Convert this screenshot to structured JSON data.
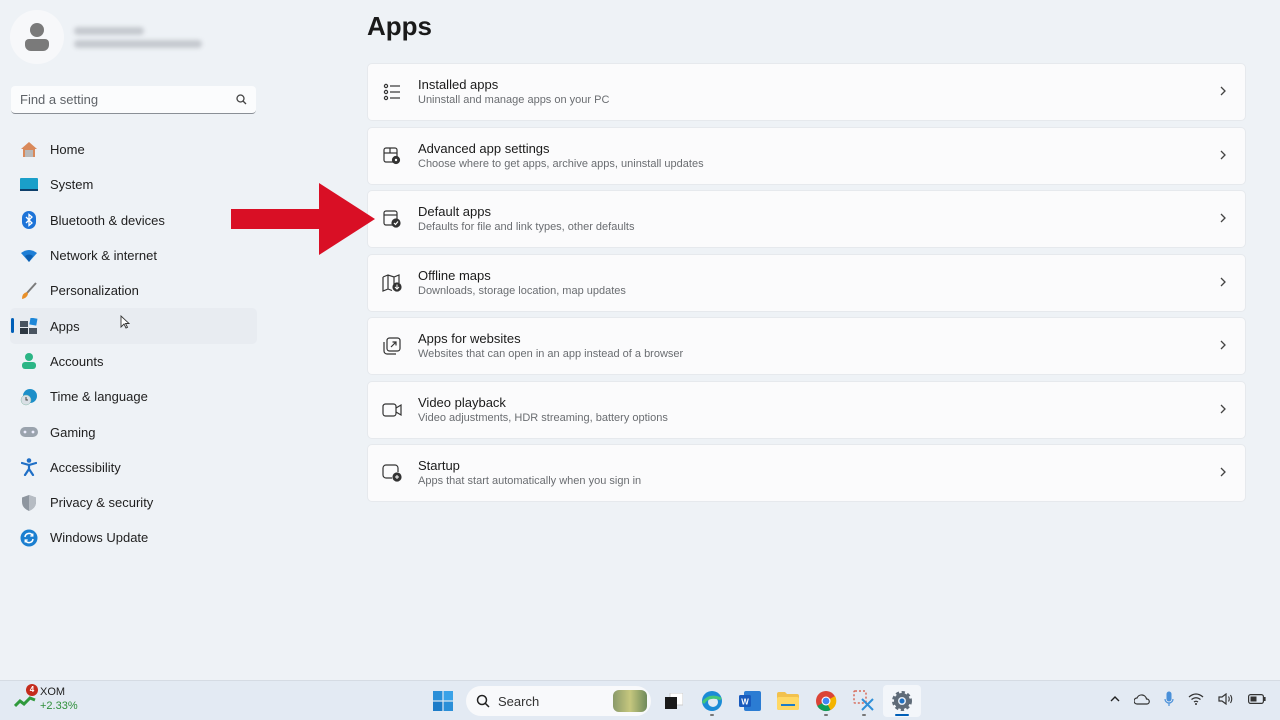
{
  "sidebar": {
    "search_placeholder": "Find a setting",
    "items": [
      {
        "label": "Home",
        "icon": "home-icon"
      },
      {
        "label": "System",
        "icon": "system-icon"
      },
      {
        "label": "Bluetooth & devices",
        "icon": "bluetooth-icon"
      },
      {
        "label": "Network & internet",
        "icon": "wifi-icon"
      },
      {
        "label": "Personalization",
        "icon": "brush-icon"
      },
      {
        "label": "Apps",
        "icon": "apps-icon",
        "active": true
      },
      {
        "label": "Accounts",
        "icon": "person-icon"
      },
      {
        "label": "Time & language",
        "icon": "globe-clock-icon"
      },
      {
        "label": "Gaming",
        "icon": "gamepad-icon"
      },
      {
        "label": "Accessibility",
        "icon": "accessibility-icon"
      },
      {
        "label": "Privacy & security",
        "icon": "shield-icon"
      },
      {
        "label": "Windows Update",
        "icon": "update-icon"
      }
    ]
  },
  "page": {
    "title": "Apps",
    "cards": [
      {
        "title": "Installed apps",
        "desc": "Uninstall and manage apps on your PC",
        "icon": "list-icon"
      },
      {
        "title": "Advanced app settings",
        "desc": "Choose where to get apps, archive apps, uninstall updates",
        "icon": "app-settings-icon"
      },
      {
        "title": "Default apps",
        "desc": "Defaults for file and link types, other defaults",
        "icon": "default-apps-icon"
      },
      {
        "title": "Offline maps",
        "desc": "Downloads, storage location, map updates",
        "icon": "map-icon"
      },
      {
        "title": "Apps for websites",
        "desc": "Websites that can open in an app instead of a browser",
        "icon": "open-in-app-icon"
      },
      {
        "title": "Video playback",
        "desc": "Video adjustments, HDR streaming, battery options",
        "icon": "video-icon"
      },
      {
        "title": "Startup",
        "desc": "Apps that start automatically when you sign in",
        "icon": "startup-icon"
      }
    ]
  },
  "taskbar": {
    "widget": {
      "symbol": "XOM",
      "change": "+2.33%",
      "badge": "4"
    },
    "search_label": "Search",
    "colors": {
      "accent": "#005fb8",
      "annotation_arrow": "#d90f25"
    }
  }
}
